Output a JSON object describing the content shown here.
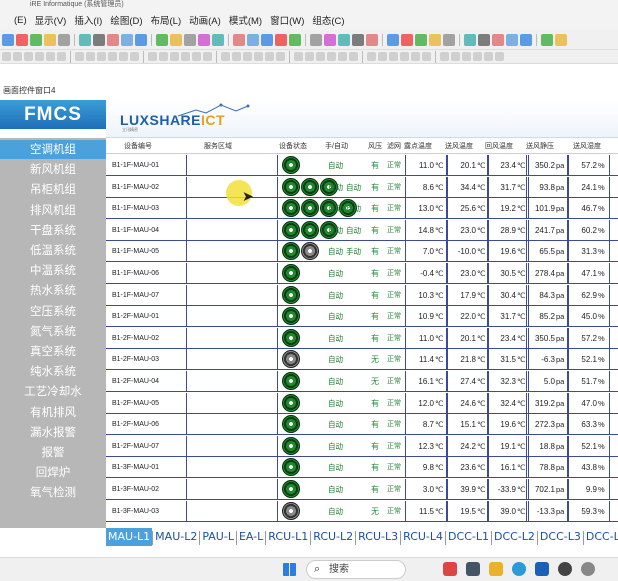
{
  "window": {
    "title_fragment": "iRE Informatique (系统管理员)"
  },
  "menu": [
    "(E)",
    "显示(V)",
    "插入(I)",
    "绘图(D)",
    "布局(L)",
    "动画(A)",
    "模式(M)",
    "窗口(W)",
    "组态(C)"
  ],
  "panel_title": "画面控件窗口4",
  "logo": {
    "fmcs": "FMCS",
    "brand_main": "LUXSHARE",
    "brand_accent": "ICT",
    "brand_sub": "立讯精密"
  },
  "sidebar": [
    "空调机组",
    "新风机组",
    "吊柜机组",
    "排风机组",
    "干盘系统",
    "低温系统",
    "中温系统",
    "热水系统",
    "空压系统",
    "氮气系统",
    "真空系统",
    "纯水系统",
    "工艺冷却水",
    "有机排风",
    "漏水报警",
    "报警",
    "回焊炉",
    "氧气检测"
  ],
  "sidebar_active": 0,
  "columns": [
    "设备编号",
    "服务区域",
    "设备状态",
    "手/自动",
    "风压",
    "滤网",
    "露点温度",
    "送风温度",
    "回风温度",
    "送风静压",
    "送风湿度"
  ],
  "rows": [
    {
      "id": "B1-1F-MAU-01",
      "fans": [
        "g"
      ],
      "mode": [
        "自动"
      ],
      "pressure": "有",
      "filter": "正常",
      "dew": "11.0",
      "supply": "20.1",
      "ret": "23.4",
      "static": "350.2",
      "hum": "57.2"
    },
    {
      "id": "B1-1F-MAU-02",
      "fans": [
        "g",
        "g",
        "g"
      ],
      "mode": [
        "自动",
        "自动"
      ],
      "pressure": "有",
      "filter": "正常",
      "dew": "8.6",
      "supply": "34.4",
      "ret": "31.7",
      "static": "93.8",
      "hum": "24.1"
    },
    {
      "id": "B1-1F-MAU-03",
      "fans": [
        "g",
        "g",
        "g",
        "g"
      ],
      "mode": [
        "自动",
        "自动"
      ],
      "pressure": "有",
      "filter": "正常",
      "dew": "13.0",
      "supply": "25.6",
      "ret": "19.2",
      "static": "101.9",
      "hum": "46.7"
    },
    {
      "id": "B1-1F-MAU-04",
      "fans": [
        "g",
        "g",
        "g"
      ],
      "mode": [
        "自动",
        "自动"
      ],
      "pressure": "有",
      "filter": "正常",
      "dew": "14.8",
      "supply": "23.0",
      "ret": "28.9",
      "static": "241.7",
      "hum": "60.2"
    },
    {
      "id": "B1-1F-MAU-05",
      "fans": [
        "g",
        "x"
      ],
      "mode": [
        "自动",
        "手动"
      ],
      "pressure": "有",
      "filter": "正常",
      "dew": "7.0",
      "supply": "-10.0",
      "ret": "19.6",
      "static": "65.5",
      "hum": "31.3"
    },
    {
      "id": "B1-1F-MAU-06",
      "fans": [
        "g"
      ],
      "mode": [
        "自动"
      ],
      "pressure": "有",
      "filter": "正常",
      "dew": "-0.4",
      "supply": "23.0",
      "ret": "30.5",
      "static": "278.4",
      "hum": "47.1"
    },
    {
      "id": "B1-1F-MAU-07",
      "fans": [
        "g"
      ],
      "mode": [
        "自动"
      ],
      "pressure": "有",
      "filter": "正常",
      "dew": "10.3",
      "supply": "17.9",
      "ret": "30.4",
      "static": "84.3",
      "hum": "62.9"
    },
    {
      "id": "B1-2F-MAU-01",
      "fans": [
        "g"
      ],
      "mode": [
        "自动"
      ],
      "pressure": "有",
      "filter": "正常",
      "dew": "10.9",
      "supply": "22.0",
      "ret": "31.7",
      "static": "85.2",
      "hum": "45.0"
    },
    {
      "id": "B1-2F-MAU-02",
      "fans": [
        "g"
      ],
      "mode": [
        "自动"
      ],
      "pressure": "有",
      "filter": "正常",
      "dew": "11.0",
      "supply": "20.1",
      "ret": "23.4",
      "static": "350.5",
      "hum": "57.2"
    },
    {
      "id": "B1-2F-MAU-03",
      "fans": [
        "x"
      ],
      "mode": [
        "自动"
      ],
      "pressure": "无",
      "filter": "正常",
      "dew": "11.4",
      "supply": "21.8",
      "ret": "31.5",
      "static": "-6.3",
      "hum": "52.1"
    },
    {
      "id": "B1-2F-MAU-04",
      "fans": [
        "g"
      ],
      "mode": [
        "自动"
      ],
      "pressure": "无",
      "filter": "正常",
      "dew": "16.1",
      "supply": "27.4",
      "ret": "32.3",
      "static": "5.0",
      "hum": "51.7"
    },
    {
      "id": "B1-2F-MAU-05",
      "fans": [
        "g"
      ],
      "mode": [
        "自动"
      ],
      "pressure": "有",
      "filter": "正常",
      "dew": "12.0",
      "supply": "24.6",
      "ret": "32.4",
      "static": "319.2",
      "hum": "47.0"
    },
    {
      "id": "B1-2F-MAU-06",
      "fans": [
        "g"
      ],
      "mode": [
        "自动"
      ],
      "pressure": "有",
      "filter": "正常",
      "dew": "8.7",
      "supply": "15.1",
      "ret": "19.6",
      "static": "272.3",
      "hum": "63.3"
    },
    {
      "id": "B1-2F-MAU-07",
      "fans": [
        "g"
      ],
      "mode": [
        "自动"
      ],
      "pressure": "有",
      "filter": "正常",
      "dew": "12.3",
      "supply": "24.2",
      "ret": "19.1",
      "static": "18.8",
      "hum": "52.1"
    },
    {
      "id": "B1-3F-MAU-01",
      "fans": [
        "g"
      ],
      "mode": [
        "自动"
      ],
      "pressure": "有",
      "filter": "正常",
      "dew": "9.8",
      "supply": "23.6",
      "ret": "16.1",
      "static": "78.8",
      "hum": "43.8"
    },
    {
      "id": "B1-3F-MAU-02",
      "fans": [
        "g"
      ],
      "mode": [
        "自动"
      ],
      "pressure": "有",
      "filter": "正常",
      "dew": "3.0",
      "supply": "39.9",
      "ret": "-33.9",
      "static": "702.1",
      "hum": "9.9"
    },
    {
      "id": "B1-3F-MAU-03",
      "fans": [
        "x"
      ],
      "mode": [
        "自动"
      ],
      "pressure": "无",
      "filter": "正常",
      "dew": "11.5",
      "supply": "19.5",
      "ret": "39.0",
      "static": "-13.3",
      "hum": "59.3"
    }
  ],
  "units": {
    "temp": "℃",
    "pressure": "pa",
    "humidity": "%"
  },
  "bottom_tabs": [
    "MAU-L1",
    "MAU-L2",
    "PAU-L",
    "EA-L",
    "RCU-L1",
    "RCU-L2",
    "RCU-L3",
    "RCU-L4",
    "DCC-L1",
    "DCC-L2",
    "DCC-L3",
    "DCC-L"
  ],
  "bottom_tab_active": 0,
  "taskbar": {
    "search": "搜索"
  },
  "colors": {
    "accent": "#4ba1dc",
    "sidebar_bg": "#b7b7b7",
    "fan_on": "#1d8a2b",
    "fan_off": "#888888",
    "status_text": "#2a8a3a"
  }
}
